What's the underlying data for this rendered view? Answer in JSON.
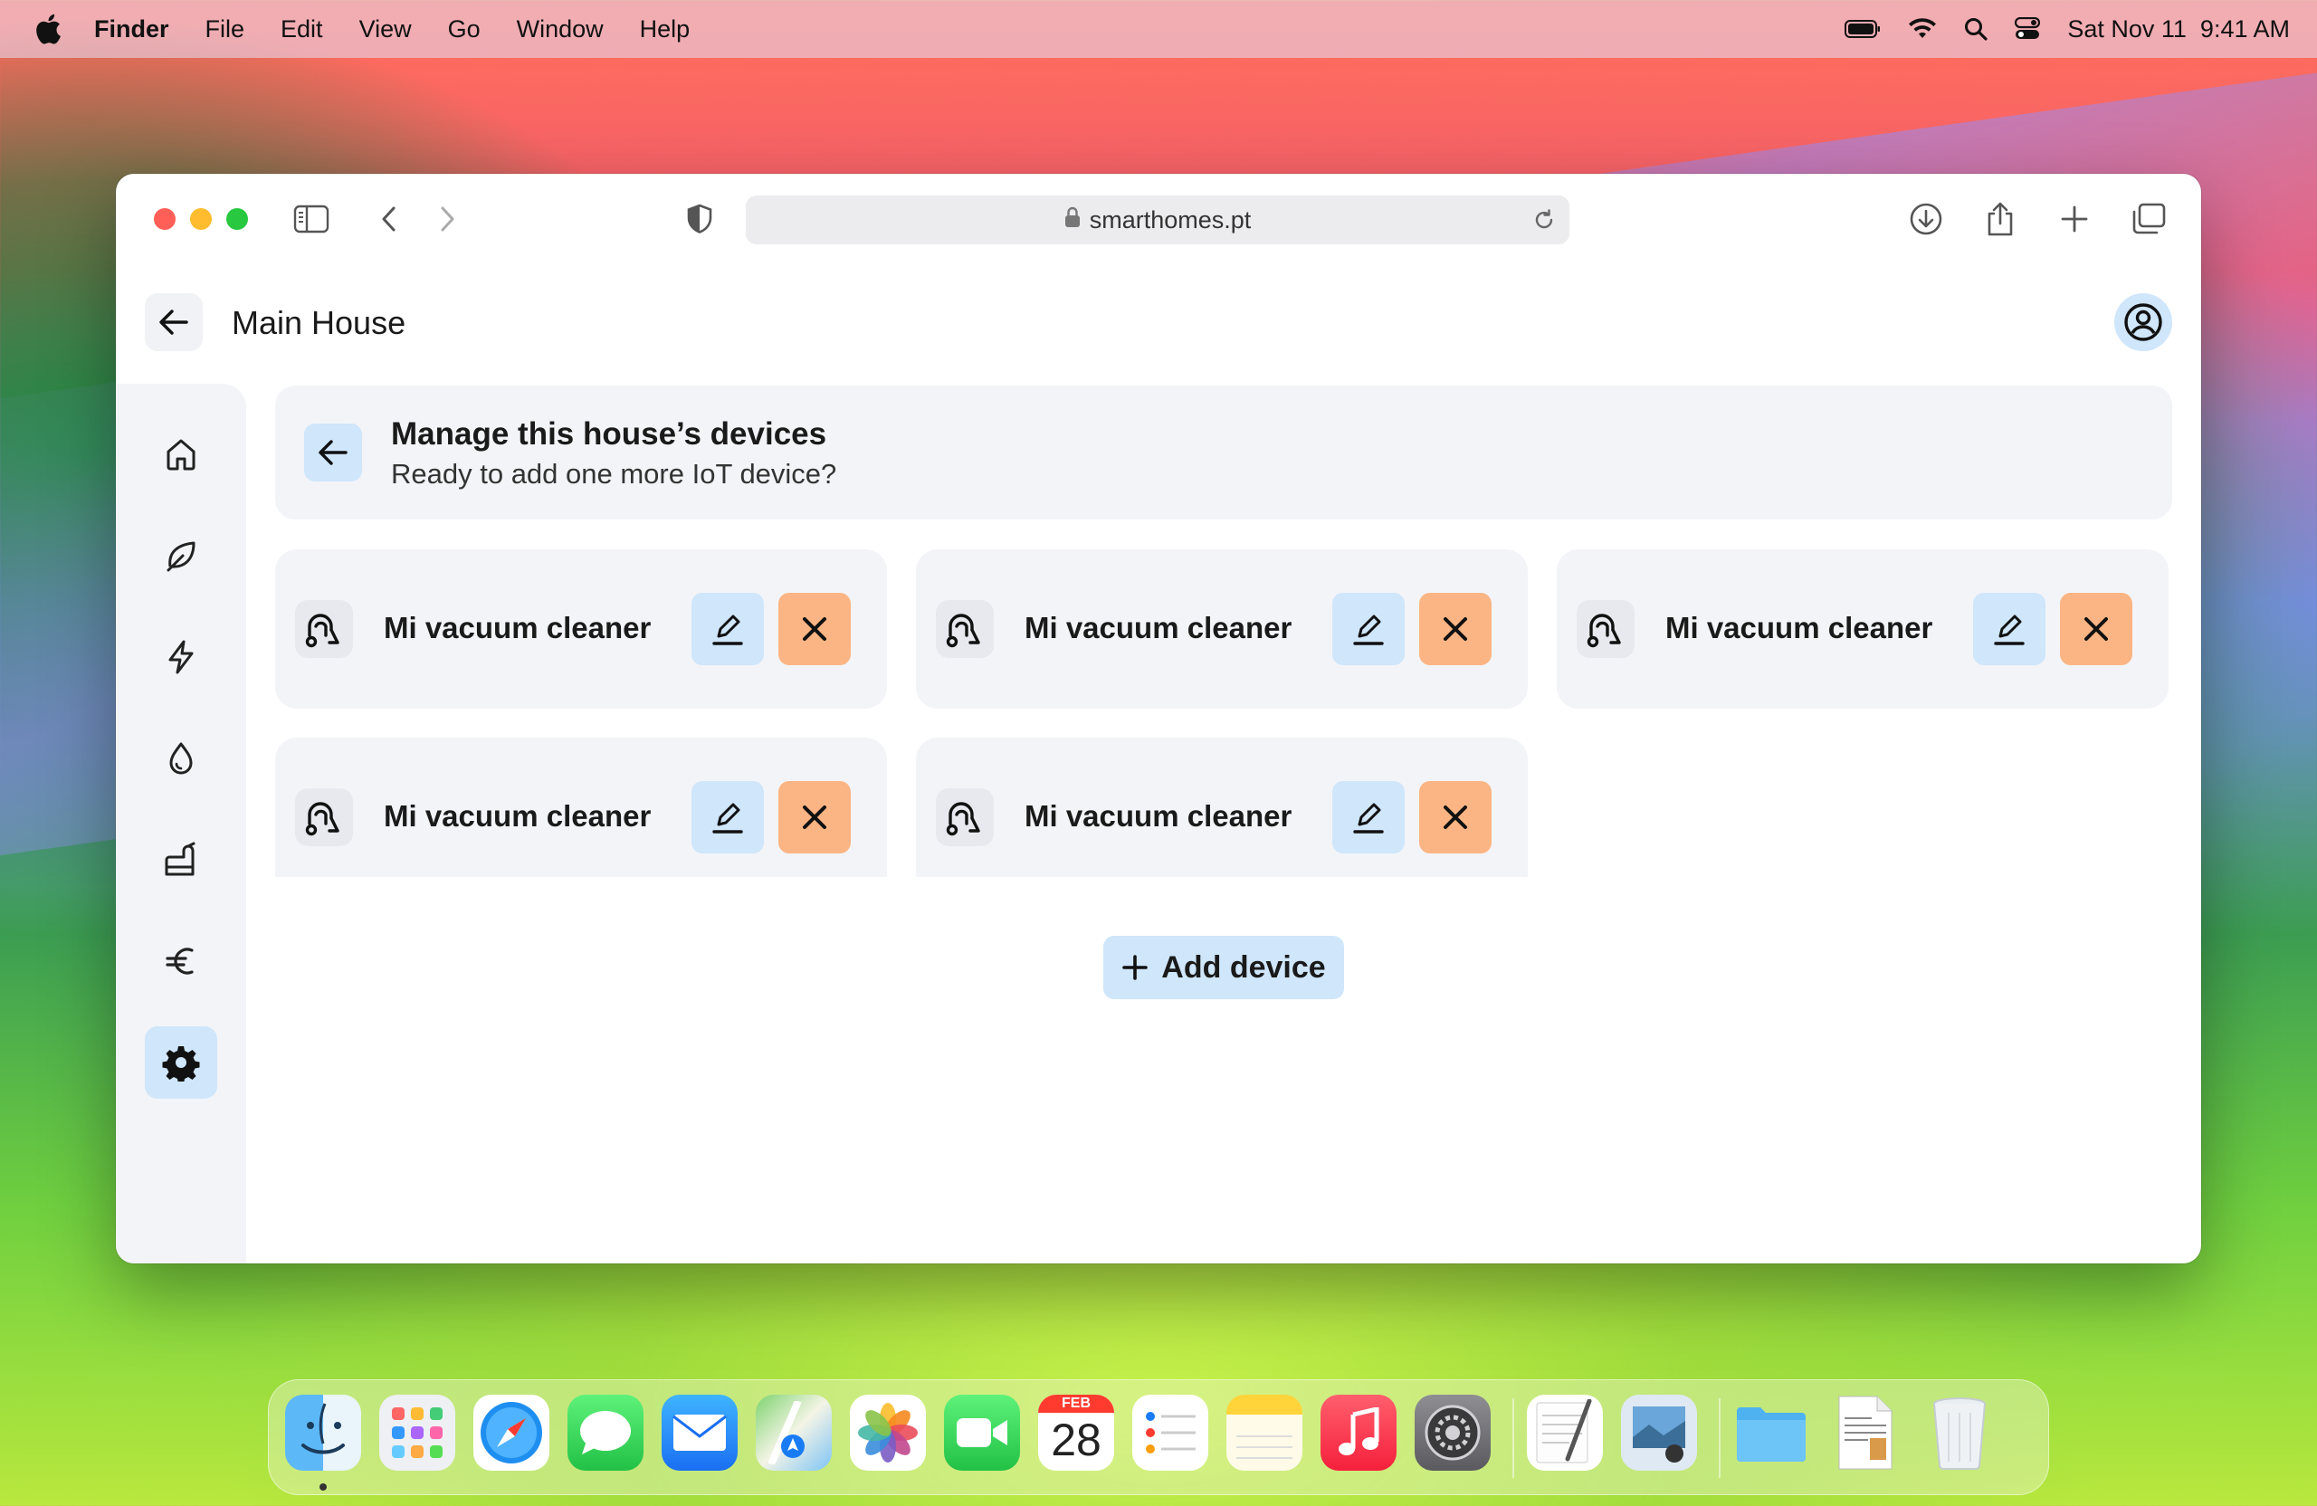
{
  "menubar": {
    "app": "Finder",
    "items": [
      "File",
      "Edit",
      "View",
      "Go",
      "Window",
      "Help"
    ],
    "clock": "Sat Nov 11  9:41 AM"
  },
  "browser": {
    "url": "smarthomes.pt"
  },
  "header": {
    "title": "Main House"
  },
  "banner": {
    "title": "Manage this house’s devices",
    "subtitle": "Ready to add one more IoT device?"
  },
  "devices": [
    {
      "name": "Mi vacuum cleaner",
      "icon": "vacuum-icon"
    },
    {
      "name": "Mi vacuum cleaner",
      "icon": "vacuum-icon"
    },
    {
      "name": "Mi vacuum cleaner",
      "icon": "vacuum-icon"
    },
    {
      "name": "Mi vacuum cleaner",
      "icon": "vacuum-icon"
    },
    {
      "name": "Mi vacuum cleaner",
      "icon": "vacuum-icon"
    }
  ],
  "actions": {
    "add_device": "Add device"
  },
  "sidebar": {
    "items": [
      {
        "icon": "home-icon"
      },
      {
        "icon": "leaf-icon"
      },
      {
        "icon": "bolt-icon"
      },
      {
        "icon": "water-drop-icon"
      },
      {
        "icon": "appliance-icon"
      },
      {
        "icon": "euro-icon"
      },
      {
        "icon": "gear-icon",
        "active": true
      }
    ]
  },
  "dock": {
    "calendar_month": "FEB",
    "calendar_day": "28"
  },
  "colors": {
    "accent_blue": "#cfe6fb",
    "delete_orange": "#fbb584",
    "card_bg": "#f3f4f8"
  }
}
